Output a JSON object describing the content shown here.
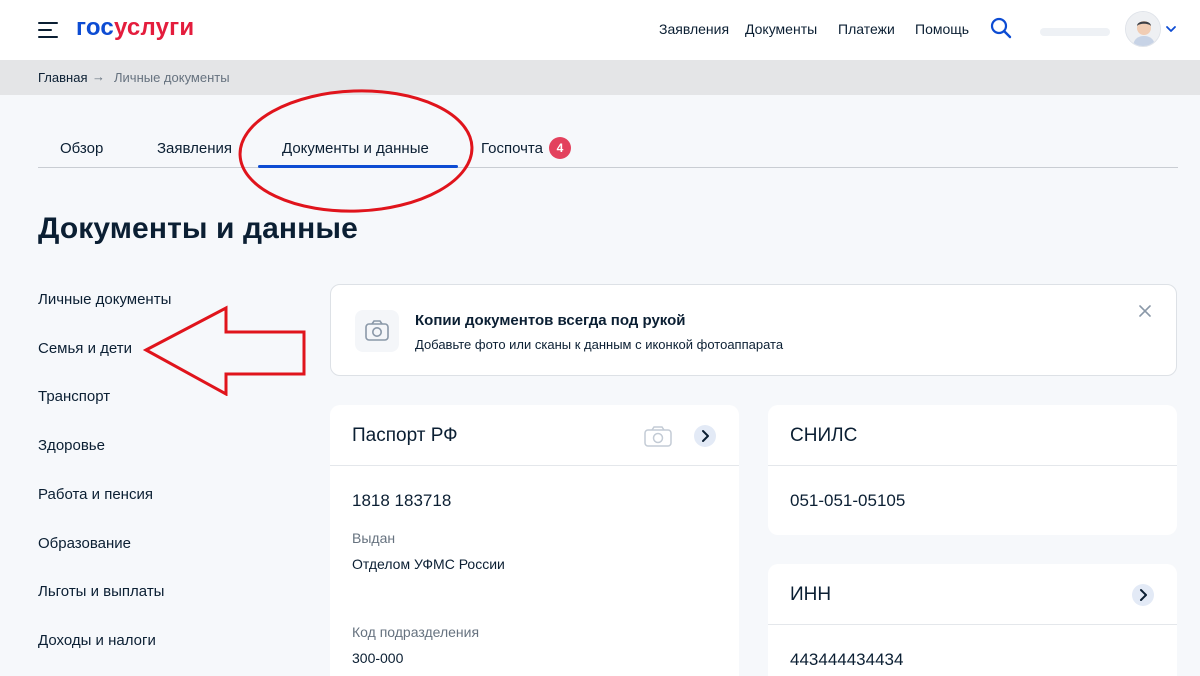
{
  "brand": {
    "part1": "гос",
    "part2": "услуги"
  },
  "header": {
    "nav": [
      "Заявления",
      "Документы",
      "Платежи",
      "Помощь"
    ]
  },
  "breadcrumb": {
    "home": "Главная",
    "separator": "→",
    "current": "Личные документы"
  },
  "tabs": [
    {
      "label": "Обзор"
    },
    {
      "label": "Заявления"
    },
    {
      "label": "Документы и данные",
      "active": true
    },
    {
      "label": "Госпочта",
      "badge": "4"
    }
  ],
  "page": {
    "title": "Документы и данные"
  },
  "sidebar": {
    "items": [
      "Личные документы",
      "Семья и дети",
      "Транспорт",
      "Здоровье",
      "Работа и пенсия",
      "Образование",
      "Льготы и выплаты",
      "Доходы и налоги"
    ]
  },
  "promo": {
    "title": "Копии документов всегда под рукой",
    "subtitle": "Добавьте фото или сканы к данным с иконкой фотоаппарата"
  },
  "documents": {
    "passport": {
      "title": "Паспорт РФ",
      "number": "1818 183718",
      "issued_label": "Выдан",
      "issued_value": "Отделом УФМС России",
      "division_label": "Код подразделения",
      "division_value": "300-000"
    },
    "snils": {
      "title": "СНИЛС",
      "number": "051-051-05105"
    },
    "inn": {
      "title": "ИНН",
      "number": "443444434434"
    }
  },
  "colors": {
    "brand_blue": "#0d4cd3",
    "brand_red": "#e41d3d",
    "badge_red": "#e3415d",
    "annotation_red": "#e0141c"
  }
}
